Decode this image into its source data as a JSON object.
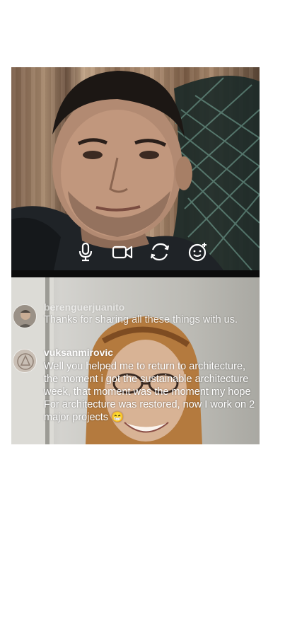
{
  "live_call": {
    "host_video": {
      "description_icon": "host-camera-feed"
    },
    "guest_video": {
      "description_icon": "guest-camera-feed"
    },
    "controls": [
      {
        "id": "mic",
        "icon": "microphone-icon"
      },
      {
        "id": "camera",
        "icon": "video-camera-icon"
      },
      {
        "id": "flip",
        "icon": "flip-camera-icon"
      },
      {
        "id": "effects",
        "icon": "face-effects-icon"
      }
    ]
  },
  "comments": [
    {
      "username": "berenguerjuanito",
      "text": "Thanks for sharing all these things with us."
    },
    {
      "username": "vuksanmirovic",
      "text": "Well you helped me to return to architecture, the moment i got the sustainable architecture week, that moment was the moment my hope For architecture was restored, now I work on 2 major projects 😁"
    }
  ],
  "colors": {
    "background": "#ffffff",
    "icon": "#ffffff",
    "separator": "#0c0c0c"
  }
}
